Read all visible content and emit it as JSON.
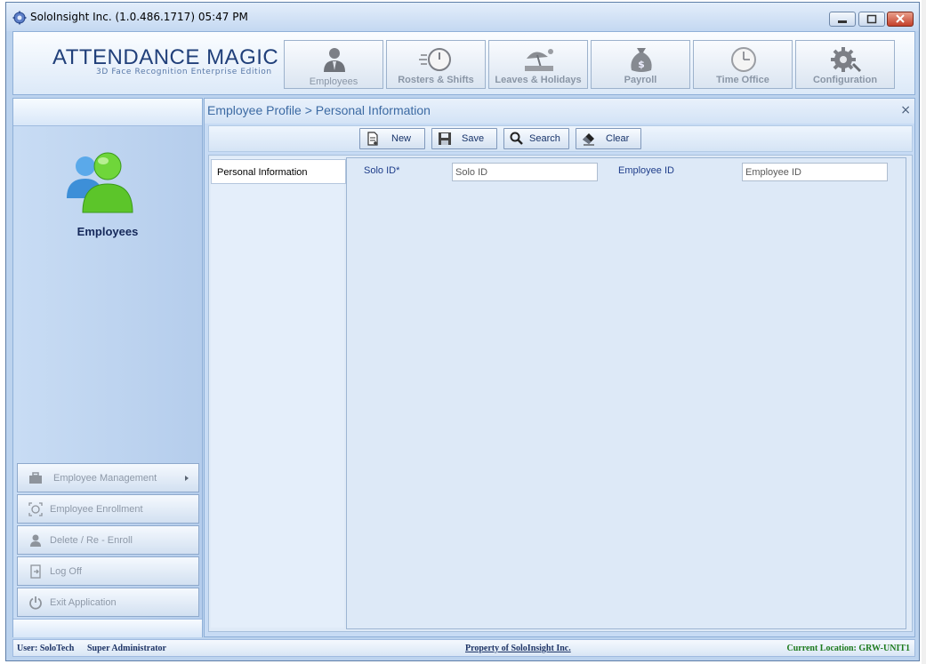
{
  "window": {
    "title": "SoloInsight Inc. (1.0.486.1717)   05:47 PM"
  },
  "brand": {
    "title": "ATTENDANCE MAGIC",
    "subtitle": "3D Face Recognition Enterprise Edition"
  },
  "nav": [
    {
      "label": "Employees",
      "icon": "employee-icon",
      "active": true
    },
    {
      "label": "Rosters & Shifts",
      "icon": "stopwatch-icon"
    },
    {
      "label": "Leaves & Holidays",
      "icon": "beach-icon"
    },
    {
      "label": "Payroll",
      "icon": "money-bag-icon"
    },
    {
      "label": "Time Office",
      "icon": "clock-icon"
    },
    {
      "label": "Configuration",
      "icon": "gear-icon"
    }
  ],
  "sidebar": {
    "title": "Employees",
    "buttons": [
      {
        "label": "Employee Management",
        "icon": "briefcase-icon",
        "has_submenu": true
      },
      {
        "label": "Employee Enrollment",
        "icon": "face-scan-icon"
      },
      {
        "label": "Delete / Re - Enroll",
        "icon": "user-delete-icon"
      },
      {
        "label": "Log Off",
        "icon": "logoff-icon"
      },
      {
        "label": "Exit Application",
        "icon": "power-icon"
      }
    ]
  },
  "main": {
    "breadcrumb": "Employee Profile > Personal Information",
    "close": "×",
    "toolbar": {
      "new": "New",
      "save": "Save",
      "search": "Search",
      "clear": "Clear"
    },
    "subnav": [
      "Personal Information"
    ],
    "form": {
      "solo_id_label": "Solo ID*",
      "solo_id_placeholder": "Solo ID",
      "employee_id_label": "Employee ID",
      "employee_id_placeholder": "Employee ID"
    }
  },
  "status": {
    "user": "User: SoloTech",
    "role": "Super Administrator",
    "property": "Property of SoloInsight Inc.",
    "location": "Current Location: GRW-UNIT1"
  },
  "colors": {
    "accent": "#21407a",
    "location_green": "#1d7a1d",
    "close_red": "#c4402a"
  }
}
